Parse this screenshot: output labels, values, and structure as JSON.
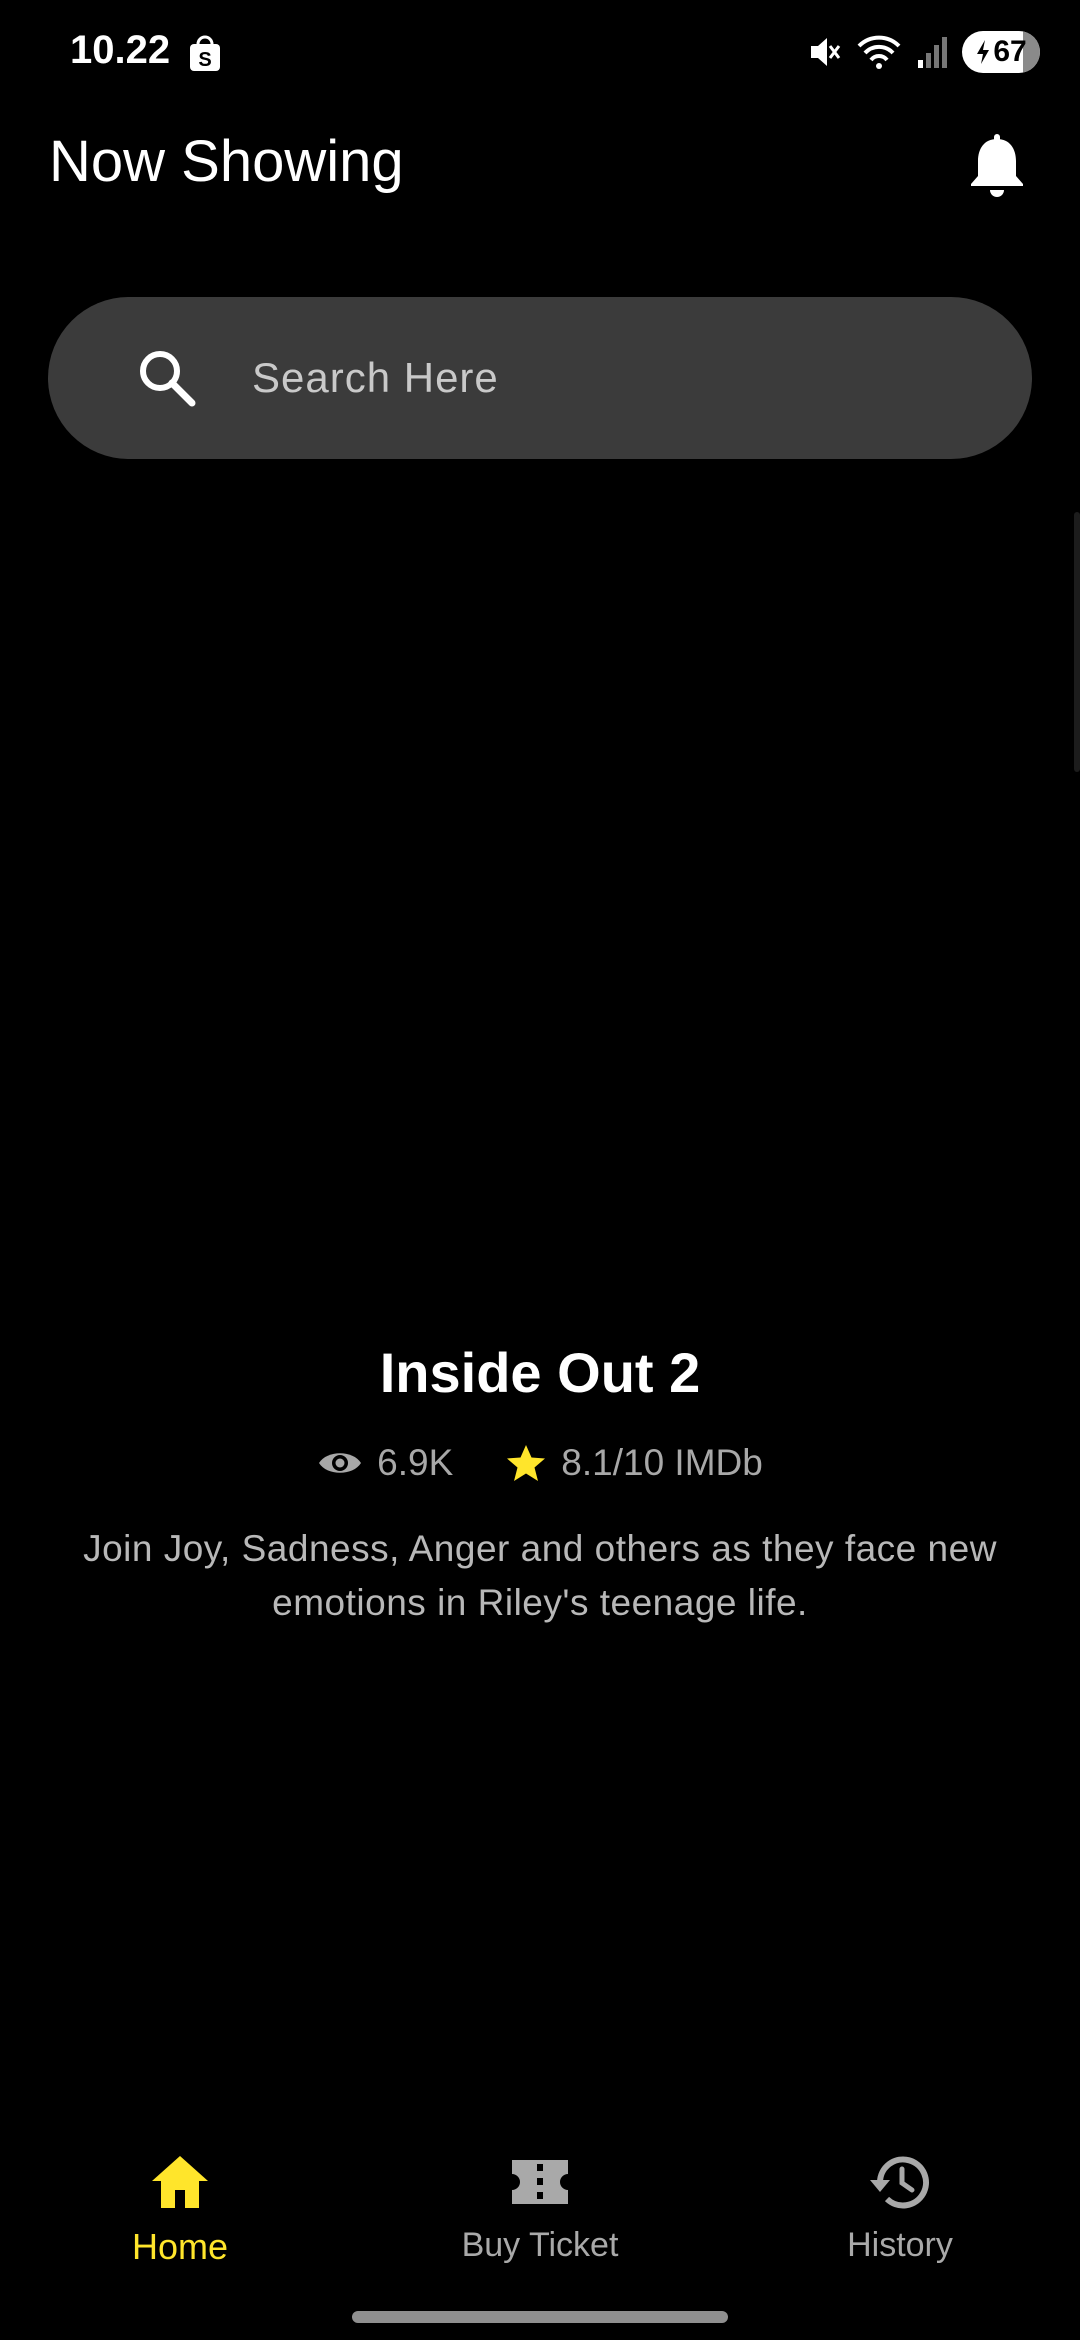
{
  "status_bar": {
    "time": "10.22",
    "battery_level": "67",
    "icons": [
      "shopping-bag-icon",
      "mute-icon",
      "wifi-icon",
      "signal-icon",
      "battery-charging-icon"
    ]
  },
  "header": {
    "title": "Now Showing",
    "notification_icon": "bell-icon"
  },
  "search": {
    "placeholder": "Search Here",
    "value": "",
    "icon": "search-icon"
  },
  "movie": {
    "title": "Inside Out 2",
    "views": "6.9K",
    "rating": "8.1/10 IMDb",
    "description": "Join Joy, Sadness, Anger and others as they face new emotions in Riley's teenage life.",
    "views_icon": "eye-icon",
    "rating_icon": "star-icon"
  },
  "bottom_nav": {
    "items": [
      {
        "label": "Home",
        "icon": "home-icon",
        "active": true
      },
      {
        "label": "Buy Ticket",
        "icon": "ticket-icon",
        "active": false
      },
      {
        "label": "History",
        "icon": "history-icon",
        "active": false
      }
    ]
  },
  "colors": {
    "background": "#000000",
    "accent": "#FFE52B",
    "search_bg": "#3B3B3B",
    "inactive": "#A9A9A9",
    "star": "#FFE52B"
  }
}
